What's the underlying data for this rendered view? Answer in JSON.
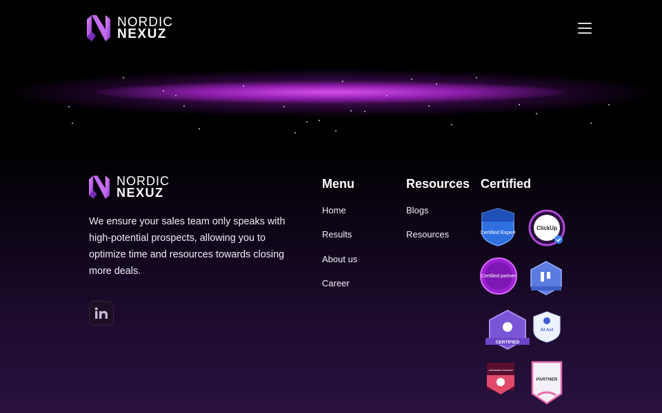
{
  "header": {
    "logo": {
      "line1": "NORDIC",
      "line2": "NEXUZ"
    },
    "menu_icon": "hamburger-menu-icon"
  },
  "footer": {
    "logo": {
      "line1": "NORDIC",
      "line2": "NEXUZ"
    },
    "about": "We ensure your sales team only speaks with high-potential prospects, allowing you to optimize time and resources towards closing more deals.",
    "social_icon": "linkedin-icon",
    "menu": {
      "title": "Menu",
      "links": [
        "Home",
        "Results",
        "About us",
        "Career"
      ]
    },
    "resources": {
      "title": "Resources",
      "links": [
        "Blogs",
        "Resources"
      ]
    },
    "certified": {
      "title": "Certified",
      "badges": [
        {
          "name": "Certified Expert"
        },
        {
          "name": "ClickUp"
        },
        {
          "name": "Certified partner"
        },
        {
          "name": "Certified badge"
        },
        {
          "name": "CERTIFIED"
        },
        {
          "name": "AI Act"
        },
        {
          "name": "Automated Inbound"
        },
        {
          "name": "PARTNER"
        }
      ]
    }
  },
  "colors": {
    "background": "#000000",
    "accent_purple": "#b52fe0",
    "gradient_bottom": "#2a123f"
  }
}
